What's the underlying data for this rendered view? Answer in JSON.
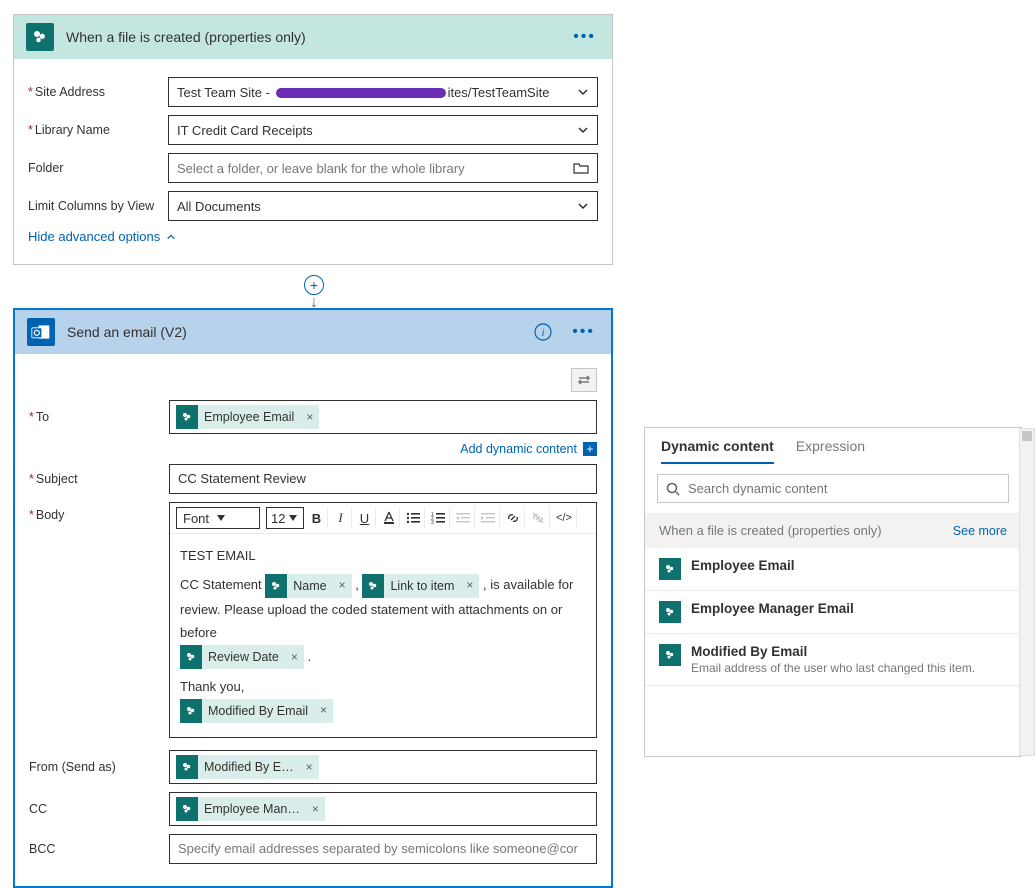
{
  "trigger": {
    "title": "When a file is created (properties only)",
    "fields": {
      "siteAddress_label": "Site Address",
      "siteAddress_prefix": "Test Team Site - ",
      "siteAddress_suffix": "ites/TestTeamSite",
      "libraryName_label": "Library Name",
      "libraryName_value": "IT Credit Card Receipts",
      "folder_label": "Folder",
      "folder_placeholder": "Select a folder, or leave blank for the whole library",
      "limitCols_label": "Limit Columns by View",
      "limitCols_value": "All Documents"
    },
    "advancedToggle": "Hide advanced options"
  },
  "action": {
    "title": "Send an email (V2)",
    "to_label": "To",
    "to_token": "Employee Email",
    "add_dynamic": "Add dynamic content",
    "subject_label": "Subject",
    "subject_value": "CC Statement Review",
    "body_label": "Body",
    "font_label": "Font",
    "font_size": "12",
    "body": {
      "line1": "TEST EMAIL",
      "line2_pre": "CC Statement ",
      "token_name": "Name",
      "sep": " , ",
      "token_link": "Link to item",
      "line2_post": " , is available for",
      "line3": "review.  Please upload the coded statement with attachments on or before",
      "token_review": "Review Date",
      "period": " .",
      "thank": "Thank you,",
      "token_modby": "Modified By Email"
    },
    "from_label": "From (Send as)",
    "from_token": "Modified By E…",
    "cc_label": "CC",
    "cc_token": "Employee Man…",
    "bcc_label": "BCC",
    "bcc_placeholder": "Specify email addresses separated by semicolons like someone@cor"
  },
  "dyn": {
    "tab1": "Dynamic content",
    "tab2": "Expression",
    "search_placeholder": "Search dynamic content",
    "group": "When a file is created (properties only)",
    "see_more": "See more",
    "items": [
      {
        "title": "Employee Email",
        "desc": ""
      },
      {
        "title": "Employee Manager Email",
        "desc": ""
      },
      {
        "title": "Modified By Email",
        "desc": "Email address of the user who last changed this item."
      }
    ]
  }
}
